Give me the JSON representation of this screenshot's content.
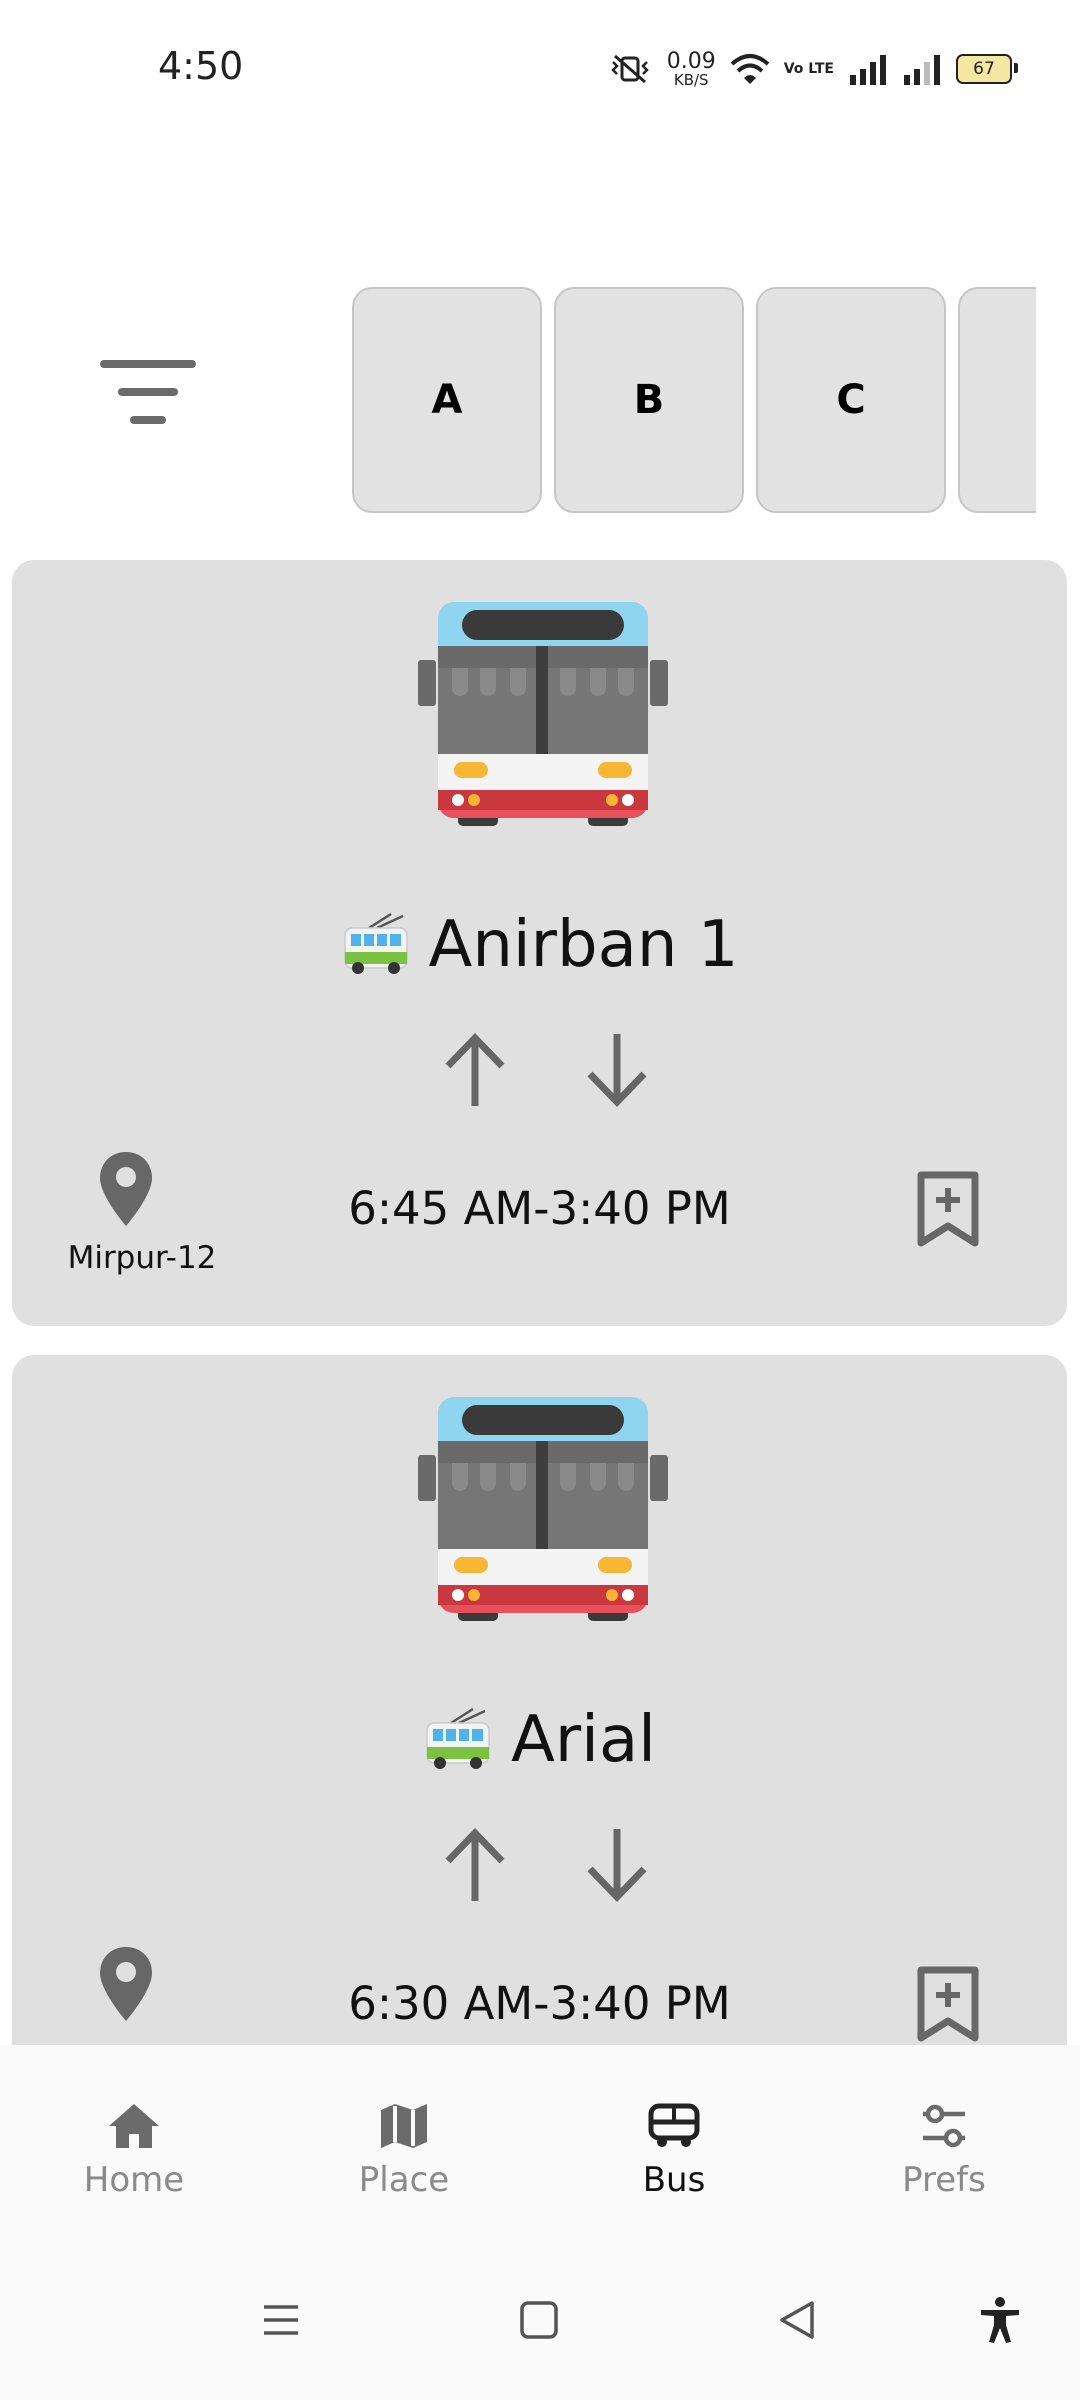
{
  "status_bar": {
    "time": "4:50",
    "net_speed_value": "0.09",
    "net_speed_unit": "KB/S",
    "volte": "Vo LTE",
    "battery": "67",
    "icons": [
      "mute-vibrate-icon",
      "wifi-icon",
      "volte-icon",
      "signal-icon",
      "signal-icon",
      "battery-icon"
    ]
  },
  "filter": {
    "icon": "filter-icon"
  },
  "letter_tabs": [
    "A",
    "B",
    "C",
    ""
  ],
  "routes": [
    {
      "name": "Anirban 1",
      "place": "Mirpur-12",
      "time_range": "6:45 AM-3:40 PM",
      "icons": [
        "bus-illustration",
        "trolleybus-icon",
        "arrow-up-icon",
        "arrow-down-icon",
        "location-pin-icon",
        "bookmark-add-icon"
      ]
    },
    {
      "name": "Arial",
      "place": "",
      "time_range": "6:30 AM-3:40 PM",
      "icons": [
        "bus-illustration",
        "trolleybus-icon",
        "arrow-up-icon",
        "arrow-down-icon",
        "location-pin-icon",
        "bookmark-add-icon"
      ]
    }
  ],
  "bottom_nav": {
    "active": "Bus",
    "items": [
      {
        "label": "Home",
        "icon": "home-icon"
      },
      {
        "label": "Place",
        "icon": "map-icon"
      },
      {
        "label": "Bus",
        "icon": "bus-icon"
      },
      {
        "label": "Prefs",
        "icon": "sliders-icon"
      }
    ]
  },
  "system_nav": [
    "menu-icon",
    "home-square-icon",
    "back-icon",
    "accessibility-icon"
  ],
  "colors": {
    "card_bg": "#e0e0e0",
    "tab_bg": "#e2e2e2",
    "icon_gray": "#6b6b6b",
    "inactive_label": "#8a8a8a",
    "bus_red": "#e8505b",
    "bus_blue": "#8fd5ef"
  }
}
